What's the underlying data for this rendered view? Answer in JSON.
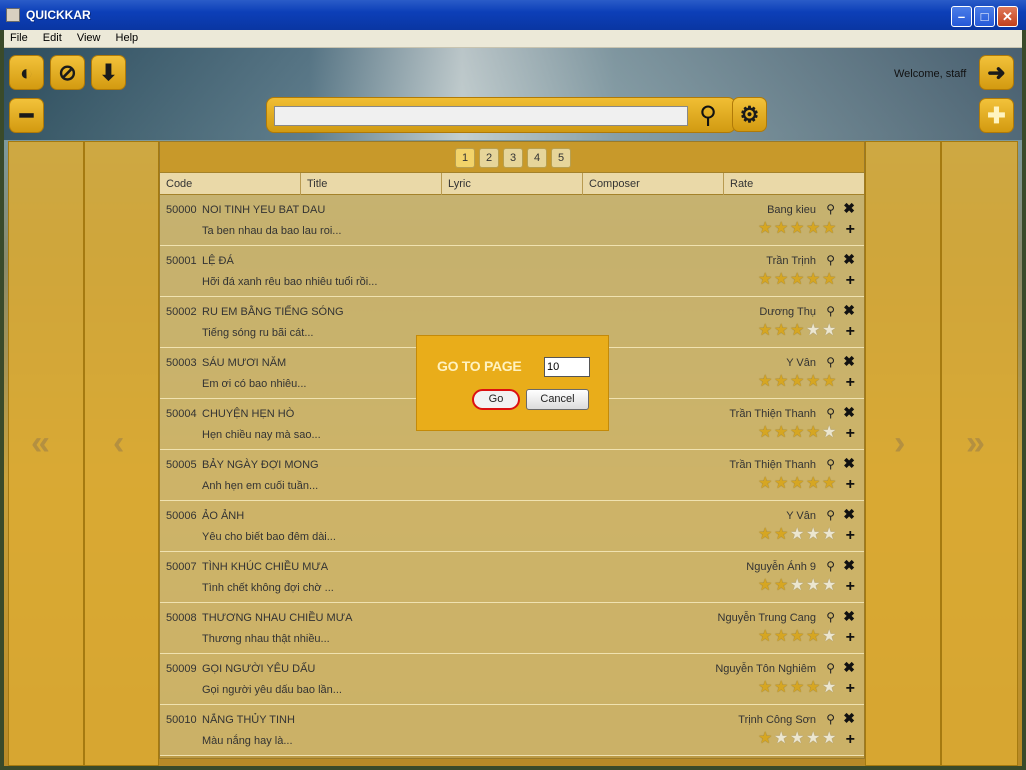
{
  "window": {
    "title": "QUICKKAR",
    "minimize": "–",
    "maximize": "□",
    "close": "✕"
  },
  "menu": [
    "File",
    "Edit",
    "View",
    "Help"
  ],
  "toolbar": {
    "welcome": "Welcome, staff",
    "icons": [
      "karaoke-mic-icon",
      "disc-icon",
      "download-icon",
      "arrow-right-icon",
      "minus-icon",
      "plus-icon",
      "search-icon",
      "gear-icon"
    ]
  },
  "search": {
    "value": ""
  },
  "pagination": {
    "pages": [
      "1",
      "2",
      "3",
      "4",
      "5"
    ],
    "active": "1"
  },
  "nav": {
    "first": "«",
    "prev": "‹",
    "next": "›",
    "last": "»"
  },
  "columns": [
    "Code",
    "Title",
    "Lyric",
    "Composer",
    "Rate"
  ],
  "songs": [
    {
      "code": "50000",
      "title": "NOI TINH YEU BAT DAU",
      "lyric": "Ta ben nhau da bao lau roi...",
      "composer": "Bang kieu",
      "rating": 5
    },
    {
      "code": "50001",
      "title": "LỆ ĐÁ",
      "lyric": "Hỡi đá xanh rêu bao nhiêu tuổi rồi...",
      "composer": "Trần Trịnh",
      "rating": 5
    },
    {
      "code": "50002",
      "title": "RU EM BẰNG TIẾNG SÓNG",
      "lyric": "Tiếng sóng ru bãi cát...",
      "composer": "Dương Thụ",
      "rating": 2.5
    },
    {
      "code": "50003",
      "title": "SÁU MƯƠI NĂM",
      "lyric": "Em ơi có bao nhiêu...",
      "composer": "Y Vân",
      "rating": 5
    },
    {
      "code": "50004",
      "title": "CHUYỆN HẸN HÒ",
      "lyric": "Hẹn chiều nay mà sao...",
      "composer": "Trần Thiện Thanh",
      "rating": 4
    },
    {
      "code": "50005",
      "title": "BẢY NGÀY ĐỢI MONG",
      "lyric": "Anh hẹn em cuối tuần...",
      "composer": "Trần Thiện Thanh",
      "rating": 5
    },
    {
      "code": "50006",
      "title": "ẢO ẢNH",
      "lyric": "Yêu cho biết bao đêm dài...",
      "composer": "Y Vân",
      "rating": 2
    },
    {
      "code": "50007",
      "title": "TÌNH KHÚC CHIỀU MƯA",
      "lyric": "Tình chết không đợi chờ ...",
      "composer": "Nguyễn Ánh 9",
      "rating": 2
    },
    {
      "code": "50008",
      "title": "THƯƠNG NHAU CHIỀU MƯA",
      "lyric": "Thương nhau thật nhiều...",
      "composer": "Nguyễn Trung Cang",
      "rating": 4
    },
    {
      "code": "50009",
      "title": "GỌI NGƯỜI YÊU DẤU",
      "lyric": "Gọi người yêu dấu bao lần...",
      "composer": "Nguyễn Tôn Nghiêm",
      "rating": 4
    },
    {
      "code": "50010",
      "title": "NẮNG THỦY TINH",
      "lyric": "Màu nắng hay là...",
      "composer": "Trịnh Công Sơn",
      "rating": 1
    }
  ],
  "dialog": {
    "title": "GO TO PAGE",
    "page_value": "10",
    "go_label": "Go",
    "cancel_label": "Cancel"
  },
  "colors": {
    "accent": "#e9ad1a",
    "highlight_ring": "#dd1111"
  }
}
